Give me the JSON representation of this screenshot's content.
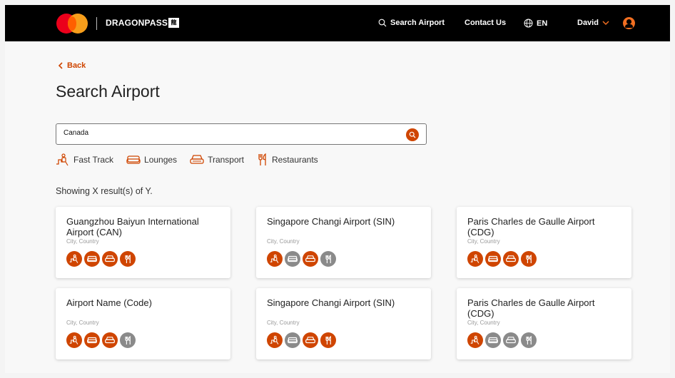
{
  "header": {
    "brand": "DRAGONPASS",
    "brand_badge": "龍",
    "search_label": "Search Airport",
    "contact_label": "Contact Us",
    "language_label": "EN",
    "user_name": "David"
  },
  "page": {
    "back_label": "Back",
    "title": "Search Airport",
    "search_value": "Canada",
    "filters": [
      "Fast Track",
      "Lounges",
      "Transport",
      "Restaurants"
    ],
    "results_text": "Showing X result(s) of Y."
  },
  "colors": {
    "accent": "#cf4500",
    "inactive": "#8a8a8a",
    "topbar": "#000000"
  },
  "icon_names": [
    "fast-track-icon",
    "lounge-icon",
    "transport-icon",
    "restaurant-icon"
  ],
  "cards": [
    {
      "name": "Guangzhou Baiyun International Airport (CAN)",
      "location": "City, Country",
      "services": [
        true,
        true,
        true,
        true
      ]
    },
    {
      "name": "Singapore Changi Airport (SIN)",
      "location": "City, Country",
      "services": [
        true,
        false,
        true,
        false
      ]
    },
    {
      "name": "Paris Charles de Gaulle Airport (CDG)",
      "location": "City, Country",
      "services": [
        true,
        true,
        true,
        true
      ]
    },
    {
      "name": "Airport Name (Code)",
      "location": "City, Country",
      "services": [
        true,
        true,
        true,
        false
      ]
    },
    {
      "name": "Singapore Changi Airport (SIN)",
      "location": "City, Country",
      "services": [
        true,
        false,
        true,
        true
      ]
    },
    {
      "name": "Paris Charles de Gaulle Airport (CDG)",
      "location": "City, Country",
      "services": [
        true,
        false,
        false,
        false
      ]
    }
  ]
}
